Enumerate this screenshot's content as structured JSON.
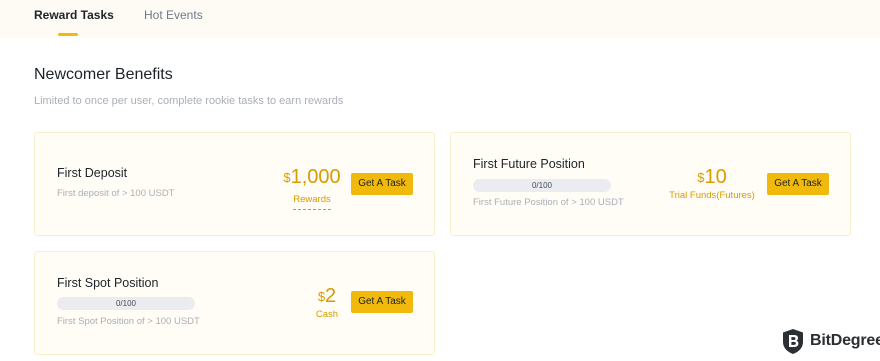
{
  "tabs": [
    {
      "label": "Reward Tasks",
      "active": true
    },
    {
      "label": "Hot Events",
      "active": false
    }
  ],
  "section": {
    "title": "Newcomer Benefits",
    "subtitle": "Limited to once per user, complete rookie tasks to earn rewards"
  },
  "tasks": {
    "first_deposit": {
      "title": "First Deposit",
      "desc": "First deposit of > 100 USDT",
      "currency": "$",
      "amount": "1,000",
      "reward_label": "Rewards",
      "button": "Get A Task"
    },
    "first_future": {
      "title": "First Future Position",
      "progress_text": "0/100",
      "progress_value": 0,
      "desc": "First Future Position of > 100 USDT",
      "currency": "$",
      "amount": "10",
      "reward_label": "Trial Funds(Futures)",
      "button": "Get A Task"
    },
    "first_spot": {
      "title": "First Spot Position",
      "progress_text": "0/100",
      "progress_value": 0,
      "desc": "First Spot Position of > 100 USDT",
      "currency": "$",
      "amount": "2",
      "reward_label": "Cash",
      "button": "Get A Task"
    }
  },
  "watermark": {
    "brand": "BitDegree",
    "icon": "bitdegree-shield-icon"
  },
  "colors": {
    "accent": "#f0b90b",
    "reward": "#d99b00",
    "card_bg": "#fffdf5"
  }
}
